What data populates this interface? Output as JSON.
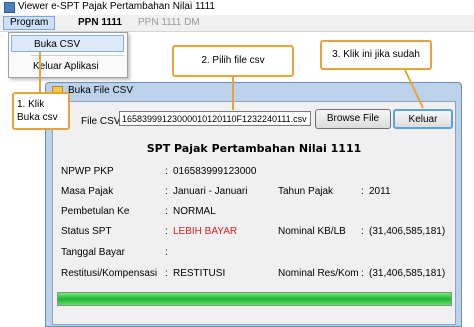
{
  "window": {
    "title": "Viewer e-SPT Pajak Pertambahan Nilai 1111"
  },
  "menubar": {
    "items": [
      {
        "label": "Program"
      },
      {
        "label": "PPN 1111"
      },
      {
        "label": "PPN 1111 DM"
      }
    ]
  },
  "dropdown": {
    "items": [
      {
        "label": "Buka CSV"
      },
      {
        "label": "Keluar Aplikasi"
      }
    ]
  },
  "callouts": {
    "step1": "1. Klik Buka csv",
    "step2": "2.  Pilih file csv",
    "step3": "3. Klik ini jika sudah"
  },
  "dialog": {
    "title": "Buka File CSV",
    "file_label": "File CSV",
    "file_value": "16583999123000010120110F1232240111.csv",
    "browse_label": "Browse File",
    "close_label": "Keluar",
    "heading": "SPT Pajak Pertambahan Nilai 1111",
    "fields": {
      "npwp": {
        "label": "NPWP PKP",
        "value": "016583999123000"
      },
      "masa": {
        "label": "Masa Pajak",
        "value": "Januari - Januari"
      },
      "tahun": {
        "label": "Tahun Pajak",
        "value": "2011"
      },
      "pembetulan": {
        "label": "Pembetulan Ke",
        "value": "NORMAL"
      },
      "status": {
        "label": "Status SPT",
        "value": "LEBIH BAYAR"
      },
      "kb_lb": {
        "label": "Nominal KB/LB",
        "value": "(31,406,585,181)"
      },
      "tanggal": {
        "label": "Tanggal Bayar",
        "value": ""
      },
      "restitusi": {
        "label": "Restitusi/Kompensasi",
        "value": "RESTITUSI"
      },
      "res_kom": {
        "label": "Nominal Res/Kom",
        "value": "(31,406,585,181)"
      }
    },
    "colon": ":",
    "progress": 1.0
  },
  "colors": {
    "callout_border": "#e8a338",
    "status_red": "#d42020",
    "progress_green": "#1fb32f"
  }
}
